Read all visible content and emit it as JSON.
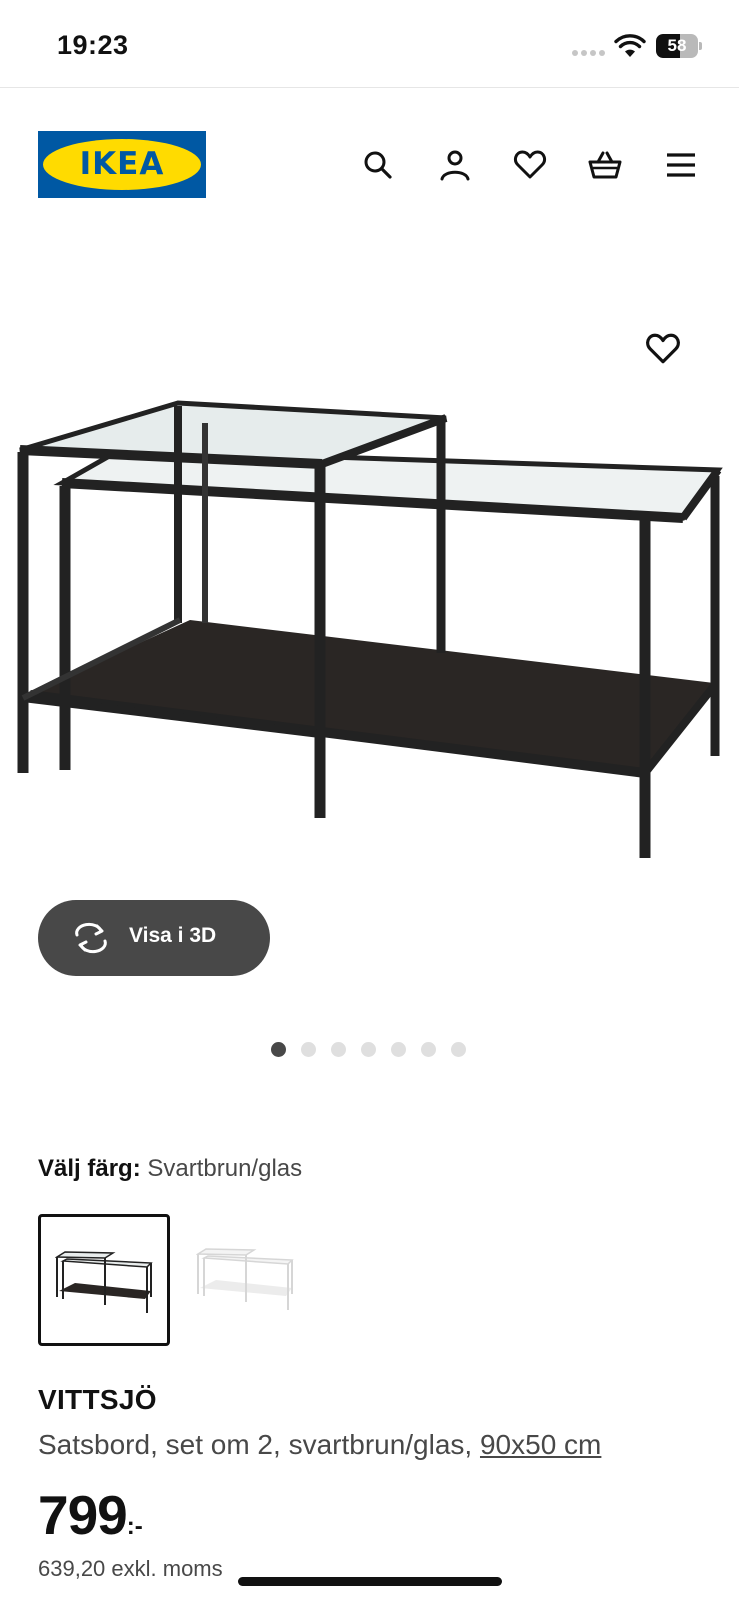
{
  "status_bar": {
    "time": "19:23",
    "battery": "58",
    "battery_level": 0.58
  },
  "header": {
    "logo_text": "IKEA",
    "icons": [
      "search-icon",
      "user-icon",
      "heart-icon",
      "basket-icon",
      "menu-icon"
    ]
  },
  "gallery": {
    "view3d_label": "Visa i 3D",
    "image_count": 7,
    "active_index": 0
  },
  "color_select": {
    "label": "Välj färg:",
    "value": "Svartbrun/glas",
    "options": [
      "Svartbrun/glas",
      "Vit/glas"
    ],
    "selected_index": 0
  },
  "product": {
    "name": "VITTSJÖ",
    "description": "Satsbord, set om 2, svartbrun/glas, ",
    "size_link": "90x50 cm",
    "price": "799",
    "price_suffix": ":-",
    "price_excl": "639,20 exkl. moms"
  },
  "colors": {
    "ikea_blue": "#0058a3",
    "ikea_yellow": "#ffdb00",
    "button_dark": "#484848",
    "frame": "#222222",
    "glass": "#eef2f2"
  }
}
